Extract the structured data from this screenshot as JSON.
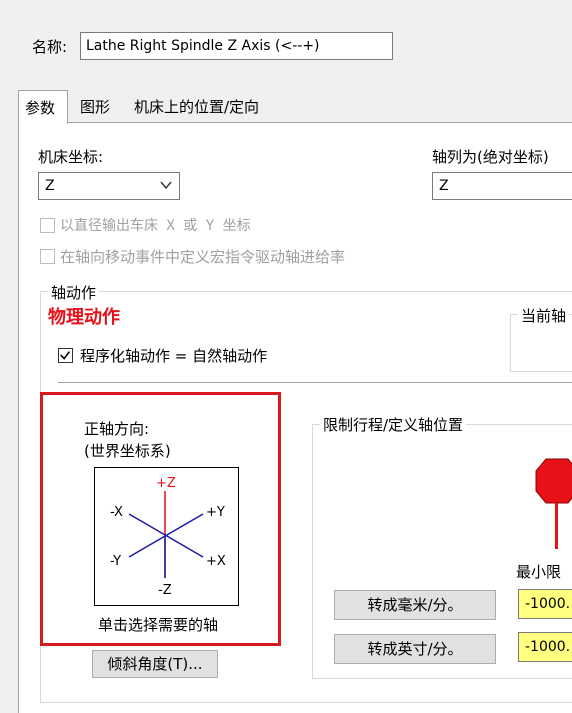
{
  "header": {
    "name_label": "名称:",
    "name_value": "Lathe Right Spindle Z Axis (<--+)"
  },
  "tabs": [
    {
      "label": "参数",
      "active": true
    },
    {
      "label": "图形",
      "active": false
    },
    {
      "label": "机床上的位置/定向",
      "active": false
    }
  ],
  "machine_coord": {
    "label": "机床坐标:",
    "value": "Z"
  },
  "axis_column": {
    "label": "轴列为(绝对坐标)",
    "value": "Z"
  },
  "options": [
    {
      "label": "以直径输出车床 X 或 Y 坐标",
      "checked": false,
      "enabled": false
    },
    {
      "label": "在轴向移动事件中定义宏指令驱动轴进给率",
      "checked": false,
      "enabled": false
    }
  ],
  "axis_motion": {
    "group_label": "轴动作",
    "physical_label": "物理动作",
    "programmed_checkbox": {
      "label": "程序化轴动作 = 自然轴动作",
      "checked": true
    },
    "current_label": "当前轴"
  },
  "positive_direction": {
    "label_line1": "正轴方向:",
    "label_line2": "(世界坐标系)",
    "axes": {
      "pz": "+Z",
      "mz": "-Z",
      "px": "+X",
      "mx": "-X",
      "py": "+Y",
      "my": "-Y"
    },
    "hint": "单击选择需要的轴"
  },
  "tilt_button": "倾斜角度(T)...",
  "limits": {
    "group_label": "限制行程/定义轴位置",
    "min_label": "最小限",
    "mm_button": "转成毫米/分。",
    "inch_button": "转成英寸/分。",
    "min_value_1": "-1000.",
    "min_value_2": "-1000."
  },
  "colors": {
    "accent_red": "#d71920",
    "stop_red": "#e8111a",
    "axis_blue": "#1a1aa6",
    "value_yellow": "#ffff80"
  }
}
